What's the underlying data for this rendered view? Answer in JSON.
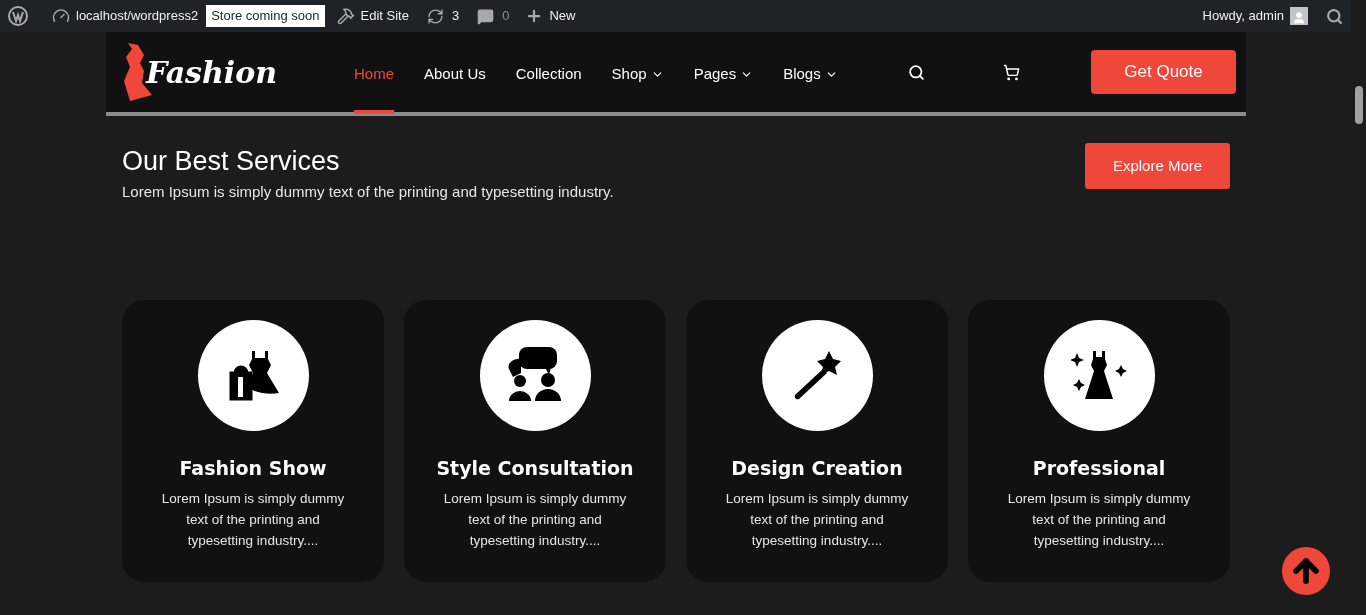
{
  "admin_bar": {
    "site": "localhost/wordpress2",
    "badge": "Store coming soon",
    "edit_site": "Edit Site",
    "updates": "3",
    "comments": "0",
    "new": "New",
    "greeting": "Howdy, admin"
  },
  "header": {
    "logo": "Fashion",
    "nav": [
      {
        "label": "Home",
        "selected": true,
        "dropdown": false
      },
      {
        "label": "About Us",
        "selected": false,
        "dropdown": false
      },
      {
        "label": "Collection",
        "selected": false,
        "dropdown": false
      },
      {
        "label": "Shop",
        "selected": false,
        "dropdown": true
      },
      {
        "label": "Pages",
        "selected": false,
        "dropdown": true
      },
      {
        "label": "Blogs",
        "selected": false,
        "dropdown": true
      }
    ],
    "cta": "Get Quote"
  },
  "services": {
    "title": "Our Best Services",
    "subtitle": "Lorem Ipsum is simply dummy text of the printing and typesetting industry.",
    "button": "Explore More",
    "cards": [
      {
        "kind": "dress-bag",
        "title": "Fashion Show",
        "text": "Lorem Ipsum is simply dummy text of the printing and typesetting industry...."
      },
      {
        "kind": "chat",
        "title": "Style Consultation",
        "text": "Lorem Ipsum is simply dummy text of the printing and typesetting industry...."
      },
      {
        "kind": "wand",
        "title": "Design Creation",
        "text": "Lorem Ipsum is simply dummy text of the printing and typesetting industry...."
      },
      {
        "kind": "dress",
        "title": "Professional",
        "text": "Lorem Ipsum is simply dummy text of the printing and typesetting industry...."
      }
    ]
  }
}
